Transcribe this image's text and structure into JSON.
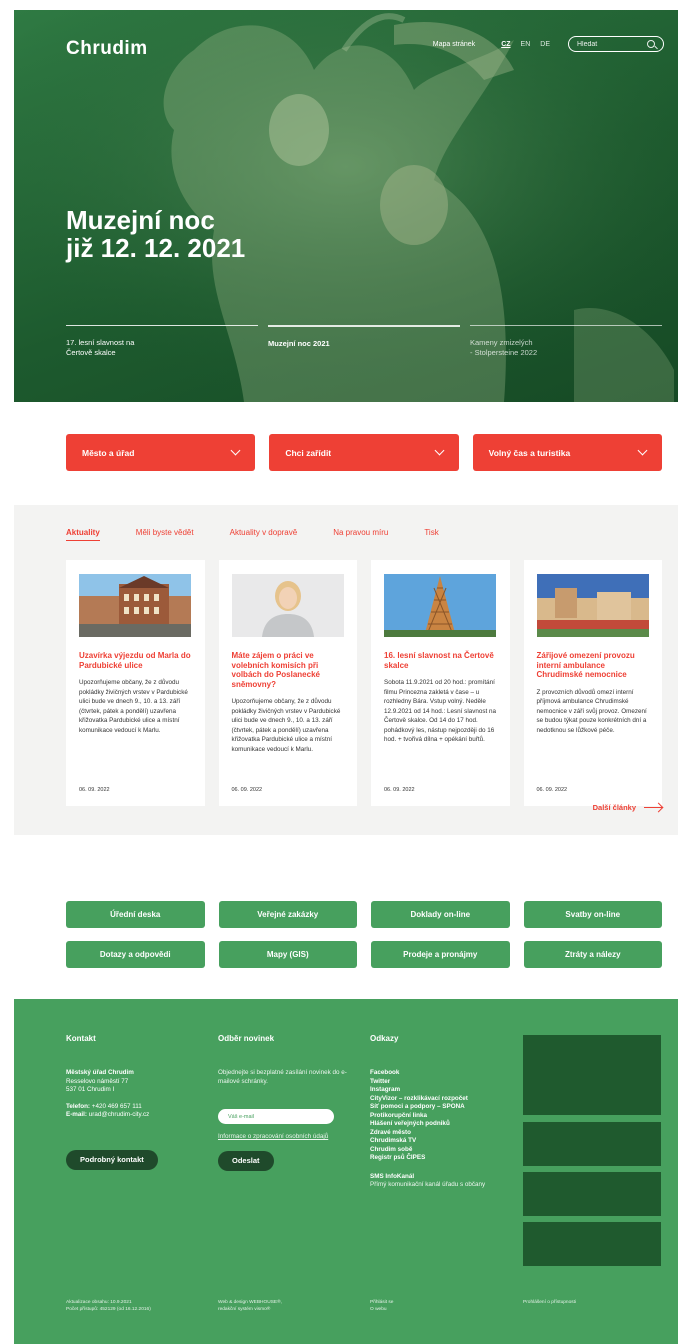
{
  "header": {
    "logo": "Chrudim",
    "sitemap": "Mapa stránek",
    "langs": [
      "CZ",
      "EN",
      "DE"
    ],
    "search_placeholder": "Hledat"
  },
  "hero": {
    "title_line1": "Muzejní noc",
    "title_line2": "již 12. 12. 2021",
    "slides": [
      {
        "line1": "17. lesní slavnost na",
        "line2": "Čertově skalce"
      },
      {
        "line1": "Muzejní noc 2021",
        "line2": ""
      },
      {
        "line1": "Kameny zmizelých",
        "line2": "- Stolpersteine 2022"
      }
    ]
  },
  "menus": [
    "Město a úřad",
    "Chci zařídit",
    "Volný čas a turistika"
  ],
  "news": {
    "tabs": [
      "Aktuality",
      "Měli byste vědět",
      "Aktuality v dopravě",
      "Na pravou míru",
      "Tisk"
    ],
    "cards": [
      {
        "title": "Uzavírka výjezdu od Marla do Pardubické ulice",
        "text": "Upozorňujeme občany, že z důvodu pokládky živičných vrstev v Pardubické ulici bude ve dnech 9., 10. a 13. září (čtvrtek, pátek a pondělí) uzavřena křižovatka Pardubické ulice a místní komunikace vedoucí k Marlu.",
        "date": "06. 09. 2022"
      },
      {
        "title": "Máte zájem o práci ve volebních komisích při volbách do Poslanecké sněmovny?",
        "text": "Upozorňujeme občany, že z důvodu pokládky živičných vrstev v Pardubické ulici bude ve dnech 9., 10. a 13. září (čtvrtek, pátek a pondělí) uzavřena křižovatka Pardubické ulice a místní komunikace vedoucí k Marlu.",
        "date": "06. 09. 2022"
      },
      {
        "title": "16. lesní slavnost na Čertově skalce",
        "text": "Sobota 11.9.2021 od 20 hod.: promítání filmu Princezna zakletá v čase – u rozhledny Bára. Vstup volný. Neděle 12.9.2021 od 14 hod.: Lesní slavnost na Čertově skalce. Od 14 do 17 hod. pohádkový les, nástup nejpozději do 16 hod. + tvořivá dílna + opékání buřtů.",
        "date": "06. 09. 2022"
      },
      {
        "title": "Zářijové omezení provozu interní ambulance Chrudimské nemocnice",
        "text": "Z provozních důvodů omezí interní příjmová ambulance Chrudimské nemocnice v září svůj provoz. Omezení se budou týkat pouze konkrétních dní a nedotknou se lůžkové péče.",
        "date": "06. 09. 2022"
      }
    ],
    "more": "Další články"
  },
  "quick_links": [
    "Úřední deska",
    "Veřejné zakázky",
    "Doklady on-line",
    "Svatby on-line",
    "Dotazy a odpovědi",
    "Mapy (GIS)",
    "Prodeje a pronájmy",
    "Ztráty a nálezy"
  ],
  "footer": {
    "contact": {
      "heading": "Kontakt",
      "org": "Městský úřad Chrudim",
      "street": "Resselovo náměstí 77",
      "city": "537 01 Chrudim I",
      "phone_label": "Telefon:",
      "phone": "+420 469 657 111",
      "email_label": "E-mail:",
      "email": "urad@chrudim-city.cz",
      "button": "Podrobný kontakt"
    },
    "newsletter": {
      "heading": "Odběr novinek",
      "text": "Objednejte si bezplatné zasílání novinek do e-mailové schránky.",
      "placeholder": "Váš e-mail",
      "privacy": "Informace o zpracování osobních údajů",
      "button": "Odeslat"
    },
    "links": {
      "heading": "Odkazy",
      "items": [
        "Facebook",
        "Twitter",
        "Instagram",
        "CityVizor – rozklikávací rozpočet",
        "Síť pomoci a podpory – SPONA",
        "Protikorupční linka",
        "Hlášení veřejných podniků",
        "Zdravé město",
        "Chrudimská TV",
        "Chrudim sobě",
        "Registr psů ČIPES"
      ],
      "sms_title": "SMS InfoKanál",
      "sms_text": "Přímý komunikační kanál úřadu s občany"
    },
    "bottom": {
      "updated": "Aktualizace obsahu: 10.9.2021",
      "visits": "Počet přístupů: 452129 (od 16.12.2016)",
      "design": "Web & design WEBHOUSE®,",
      "cms": "redakční systém vismo®",
      "login": "Přihlásit se",
      "about": "O webu",
      "accessibility": "Prohlášení o přístupnosti"
    }
  },
  "colors": {
    "accent_red": "#ee4035",
    "green": "#47a05e",
    "dark_green": "#1f4a2b"
  }
}
